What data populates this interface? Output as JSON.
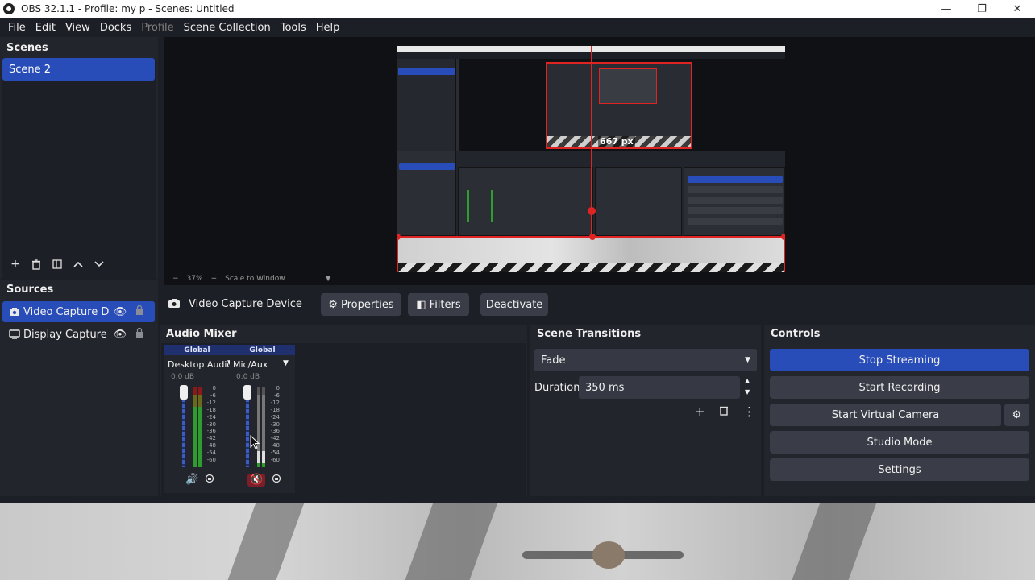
{
  "window": {
    "title": "OBS 32.1.1 - Profile: my p - Scenes: Untitled",
    "minimize": "—",
    "maximize": "❐",
    "close": "✕"
  },
  "menu": [
    "File",
    "Edit",
    "View",
    "Docks",
    "Profile",
    "Scene Collection",
    "Tools",
    "Help"
  ],
  "scenes": {
    "title": "Scenes",
    "items": [
      "Scene 2"
    ]
  },
  "preview": {
    "px_readout": "667 px",
    "zoom": "37%",
    "scale_mode": "Scale to Window"
  },
  "sources": {
    "title": "Sources",
    "items": [
      {
        "name": "Video Capture Devi",
        "icon": "camera-icon",
        "selected": true
      },
      {
        "name": "Display Capture",
        "icon": "monitor-icon",
        "selected": false
      }
    ]
  },
  "source_toolbar": {
    "label": "Video Capture Device",
    "properties": "Properties",
    "filters": "Filters",
    "deactivate": "Deactivate"
  },
  "mixer": {
    "title": "Audio Mixer",
    "channels": [
      {
        "badge": "Global",
        "name": "Desktop Audio",
        "db": "0.0 dB",
        "muted": false
      },
      {
        "badge": "Global",
        "name": "Mic/Aux",
        "db": "0.0 dB",
        "muted": true
      }
    ],
    "scale": [
      "0",
      "-6",
      "-12",
      "-18",
      "-24",
      "-30",
      "-36",
      "-42",
      "-48",
      "-54",
      "-60"
    ]
  },
  "transitions": {
    "title": "Scene Transitions",
    "selected": "Fade",
    "duration_label": "Duration",
    "duration_value": "350 ms"
  },
  "controls": {
    "title": "Controls",
    "stop_streaming": "Stop Streaming",
    "start_recording": "Start Recording",
    "start_virtual_camera": "Start Virtual Camera",
    "studio_mode": "Studio Mode",
    "settings": "Settings"
  },
  "colors": {
    "accent": "#284cb8",
    "selection_red": "#e02424",
    "panel": "#23252c",
    "background": "#1d1f26"
  }
}
